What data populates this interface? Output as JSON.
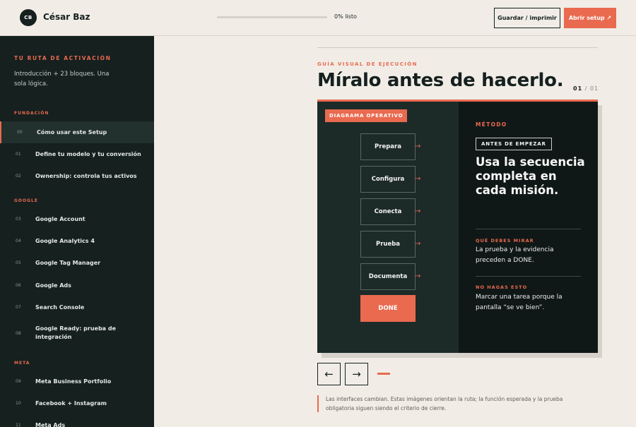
{
  "header": {
    "avatar_initials": "CB",
    "user_name": "César Baz",
    "progress_fraction": 0,
    "progress_label": "0% listo",
    "save_label": "Guardar / imprimir",
    "setup_label": "Abrir setup ↗"
  },
  "sidebar": {
    "heading": "TU RUTA DE ACTIVACIÓN",
    "intro": "Introducción + 23 bloques. Una sola lógica.",
    "sections": [
      {
        "title": "FUNDACIÓN"
      },
      {
        "title": "GOOGLE"
      },
      {
        "title": "META"
      }
    ],
    "items": [
      {
        "num": "00",
        "label": "Cómo usar este Setup",
        "active": true
      },
      {
        "num": "01",
        "label": "Define tu modelo y tu conversión"
      },
      {
        "num": "02",
        "label": "Ownership: controla tus activos"
      },
      {
        "num": "03",
        "label": "Google Account"
      },
      {
        "num": "04",
        "label": "Google Analytics 4"
      },
      {
        "num": "05",
        "label": "Google Tag Manager"
      },
      {
        "num": "06",
        "label": "Google Ads"
      },
      {
        "num": "07",
        "label": "Search Console"
      },
      {
        "num": "08",
        "label": "Google Ready: prueba de integración"
      },
      {
        "num": "09",
        "label": "Meta Business Portfolio"
      },
      {
        "num": "10",
        "label": "Facebook + Instagram"
      },
      {
        "num": "11",
        "label": "Meta Ads"
      }
    ]
  },
  "main": {
    "eyebrow": "GUÍA VISUAL DE EJECUCIÓN",
    "title": "Míralo antes de hacerlo.",
    "pager_current": "01",
    "pager_sep": "/",
    "pager_total": "01"
  },
  "card": {
    "diagram_tag": "DIAGRAMA OPERATIVO",
    "steps": [
      "Prepara",
      "Configura",
      "Conecta",
      "Prueba",
      "Documenta"
    ],
    "arrow": "→",
    "done_label": "DONE",
    "kicker": "MÉTODO",
    "badge": "ANTES DE EMPEZAR",
    "headline": "Usa la secuencia completa en cada misión.",
    "watch_title": "QUÉ DEBES MIRAR",
    "watch_text": "La prueba y la evidencia preceden a DONE.",
    "dont_title": "NO HAGAS ESTO",
    "dont_text": "Marcar una tarea porque la pantalla “se ve bien”."
  },
  "controls": {
    "prev": "←",
    "next": "→"
  },
  "note": "Las interfaces cambian. Estas imágenes orientan la ruta; la función esperada y la prueba obligatoria siguen siendo el criterio de cierre.",
  "colors": {
    "accent": "#e96a4f",
    "dark": "#15201f",
    "background": "#f1ede6"
  }
}
